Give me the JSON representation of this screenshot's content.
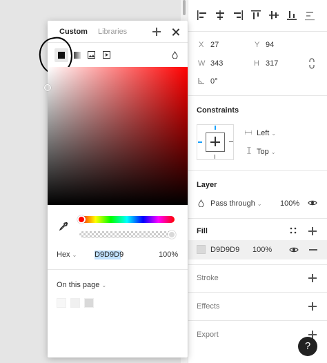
{
  "colors": {
    "accent": "#18a0fb",
    "fill_swatch": "#d9d9d9",
    "page_swatches": [
      "#f7f7f7",
      "#f0f0f0",
      "#d9d9d9"
    ]
  },
  "picker": {
    "tabs": [
      "Custom",
      "Libraries"
    ],
    "hex_mode": "Hex",
    "hex_value": "D9D9D9",
    "opacity": "100%",
    "on_this_page": "On this page"
  },
  "panel": {
    "position": {
      "x_label": "X",
      "x": "27",
      "y_label": "Y",
      "y": "94"
    },
    "size": {
      "w_label": "W",
      "w": "343",
      "h_label": "H",
      "h": "317"
    },
    "rotation": "0°",
    "constraints": {
      "title": "Constraints",
      "horizontal": "Left",
      "vertical": "Top"
    },
    "layer": {
      "title": "Layer",
      "blend": "Pass through",
      "opacity": "100%"
    },
    "fill": {
      "title": "Fill",
      "hex": "D9D9D9",
      "opacity": "100%"
    },
    "stroke": "Stroke",
    "effects": "Effects",
    "export": "Export"
  },
  "help": "?"
}
